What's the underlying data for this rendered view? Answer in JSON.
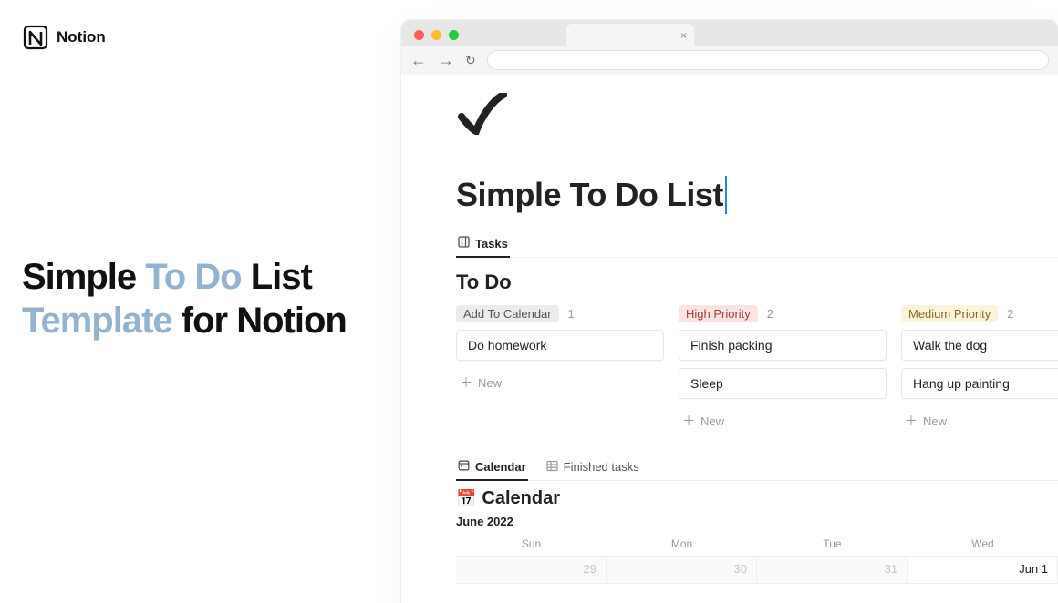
{
  "promo": {
    "brand": "Notion",
    "title_parts": {
      "p1": "Simple ",
      "accent1": "To Do",
      "p2": " List ",
      "accent2": "Template",
      "p3": " for Notion"
    }
  },
  "page": {
    "title": "Simple To Do List",
    "views_primary": {
      "tasks": "Tasks"
    },
    "views_secondary": {
      "calendar": "Calendar",
      "finished": "Finished tasks"
    },
    "section_todo": "To Do",
    "columns": [
      {
        "label": "Add To Calendar",
        "count": "1",
        "tag_class": "tag-grey",
        "cards": [
          "Do homework"
        ]
      },
      {
        "label": "High Priority",
        "count": "2",
        "tag_class": "tag-red",
        "cards": [
          "Finish packing",
          "Sleep"
        ]
      },
      {
        "label": "Medium Priority",
        "count": "2",
        "tag_class": "tag-yellow",
        "cards": [
          "Walk the dog",
          "Hang up painting"
        ]
      }
    ],
    "new_label": "New",
    "calendar_heading": "Calendar",
    "month": "June 2022",
    "weekdays": [
      "Sun",
      "Mon",
      "Tue",
      "Wed"
    ],
    "dates": [
      {
        "label": "29",
        "faded": true
      },
      {
        "label": "30",
        "faded": true
      },
      {
        "label": "31",
        "faded": true
      },
      {
        "label": "Jun 1",
        "faded": false
      }
    ]
  }
}
